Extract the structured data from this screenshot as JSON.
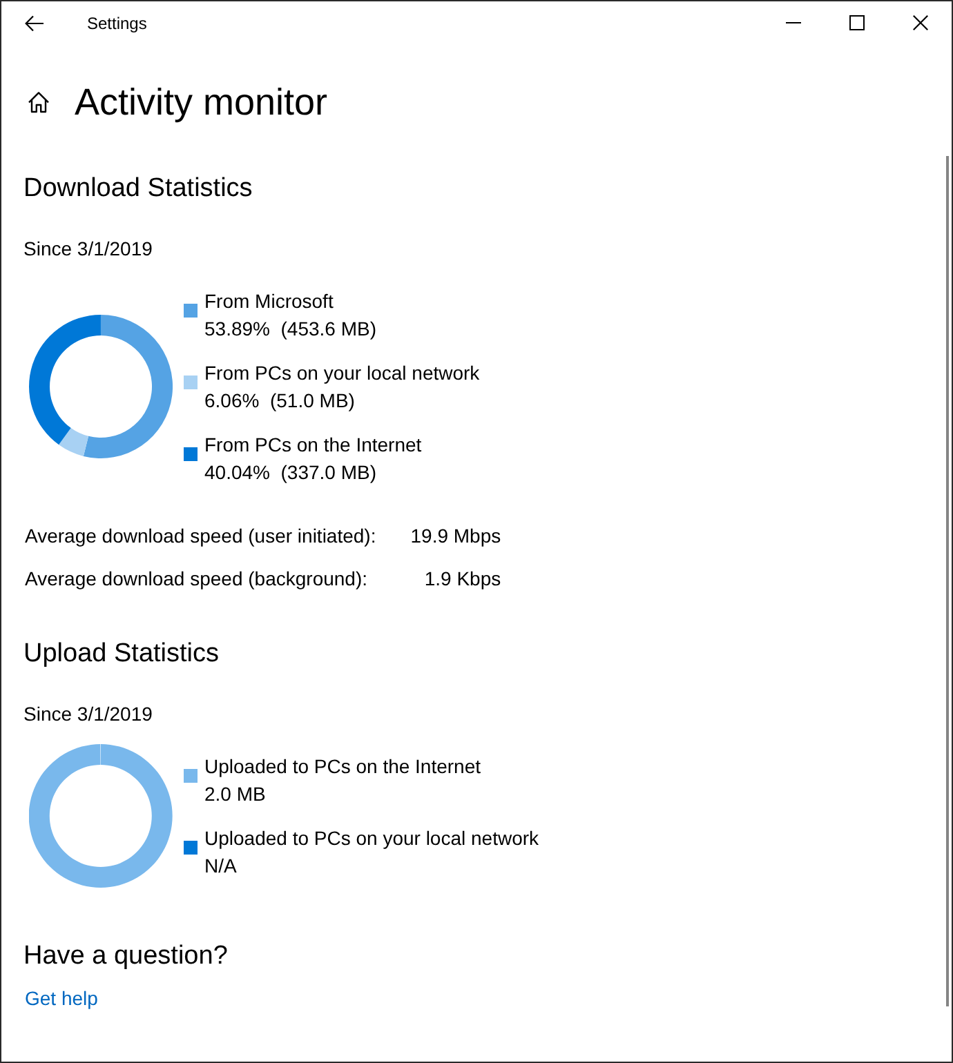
{
  "window": {
    "title": "Settings"
  },
  "page": {
    "title": "Activity monitor"
  },
  "download": {
    "heading": "Download Statistics",
    "since": "Since 3/1/2019",
    "chart_data": {
      "type": "donut",
      "legend": "right",
      "categories": [
        "From Microsoft",
        "From PCs on your local network",
        "From PCs on the Internet"
      ],
      "values": [
        53.89,
        6.06,
        40.04
      ],
      "value_labels": [
        "53.89%  (453.6 MB)",
        "6.06%  (51.0 MB)",
        "40.04%  (337.0 MB)"
      ],
      "colors": [
        "#55a3e4",
        "#a8d1f3",
        "#0078d7"
      ]
    },
    "speeds": [
      {
        "label": "Average download speed (user initiated):",
        "value": "19.9 Mbps"
      },
      {
        "label": "Average download speed (background):",
        "value": "1.9 Kbps"
      }
    ]
  },
  "upload": {
    "heading": "Upload Statistics",
    "since": "Since 3/1/2019",
    "legend": [
      {
        "label": "Uploaded to PCs on the Internet",
        "value": "2.0 MB",
        "color": "#79b8ec"
      },
      {
        "label": "Uploaded to PCs on your local network",
        "value": "N/A",
        "color": "#0078d7"
      }
    ]
  },
  "help": {
    "heading": "Have a question?",
    "link": "Get help"
  }
}
